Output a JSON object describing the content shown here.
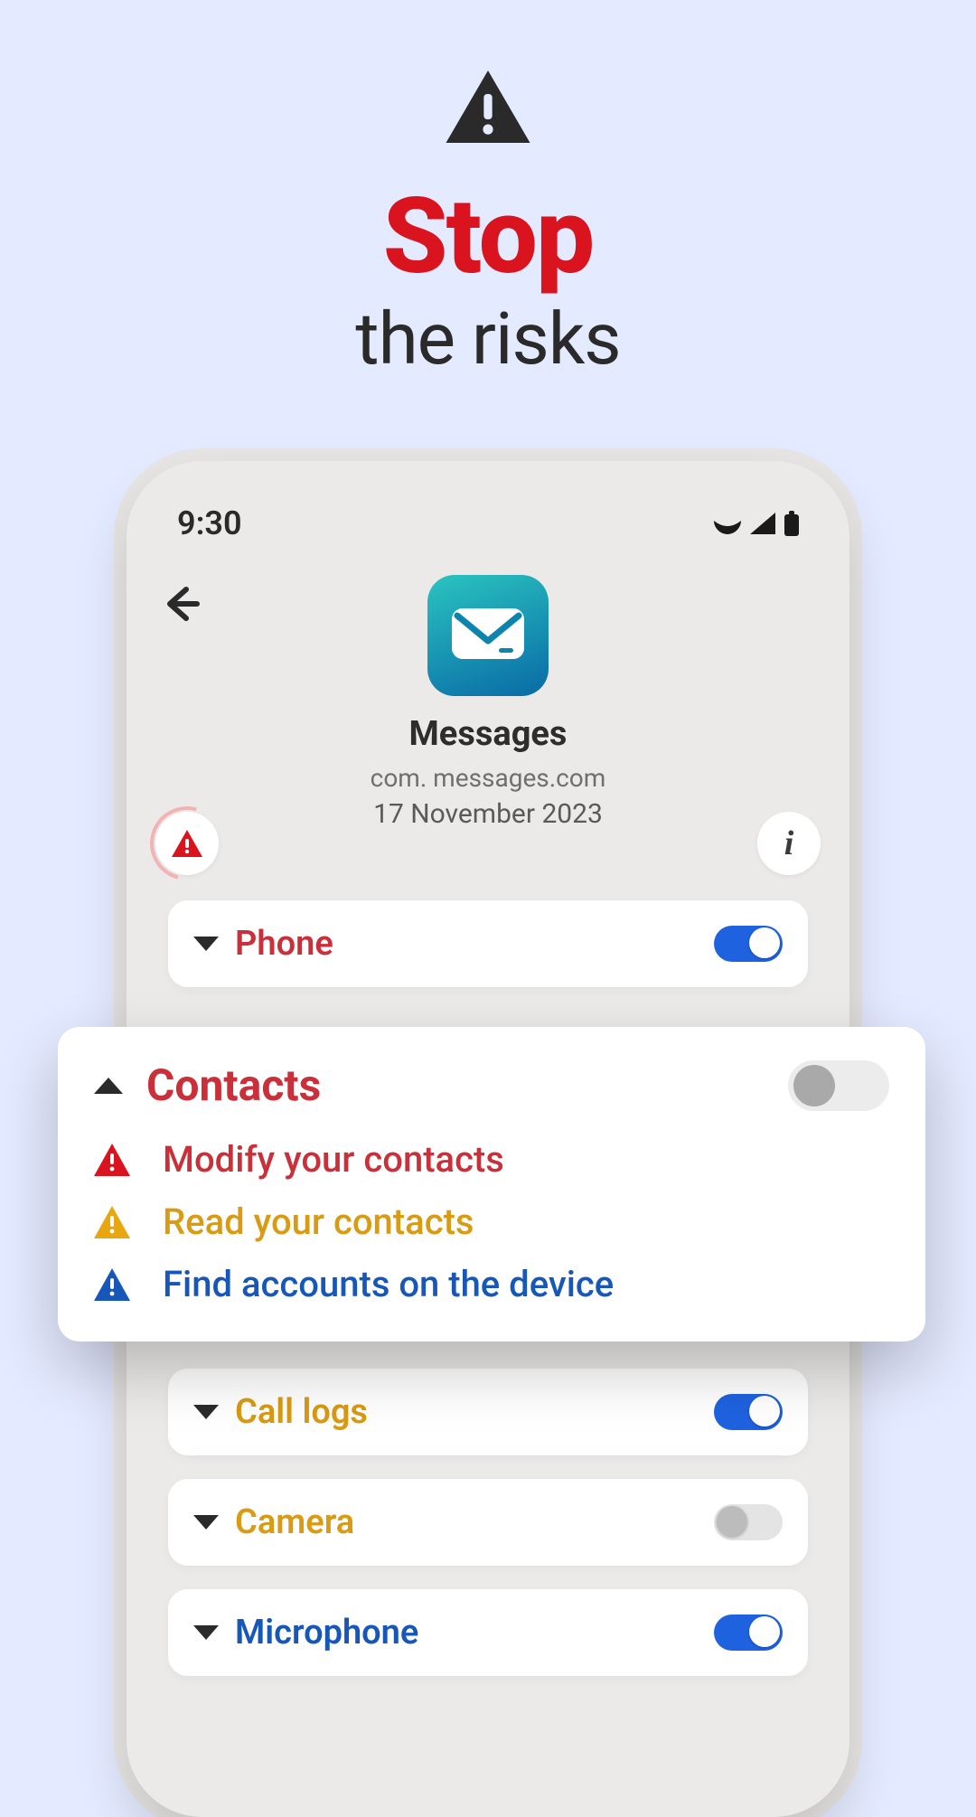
{
  "hero": {
    "title": "Stop",
    "subtitle": "the risks"
  },
  "statusbar": {
    "time": "9:30"
  },
  "app": {
    "name": "Messages",
    "package": "com. messages.com",
    "date": "17 November 2023"
  },
  "permissions": {
    "phone": {
      "label": "Phone",
      "colorClass": "cl-red",
      "on": true
    },
    "calllogs": {
      "label": "Call logs",
      "colorClass": "cl-amber",
      "on": true
    },
    "camera": {
      "label": "Camera",
      "colorClass": "cl-amber",
      "on": false
    },
    "microphone": {
      "label": "Microphone",
      "colorClass": "cl-blue",
      "on": true
    }
  },
  "expanded": {
    "title": "Contacts",
    "on": false,
    "items": [
      {
        "label": "Modify your contacts",
        "severity": "danger"
      },
      {
        "label": "Read your contacts",
        "severity": "warning"
      },
      {
        "label": "Find accounts on the device",
        "severity": "info"
      }
    ]
  }
}
